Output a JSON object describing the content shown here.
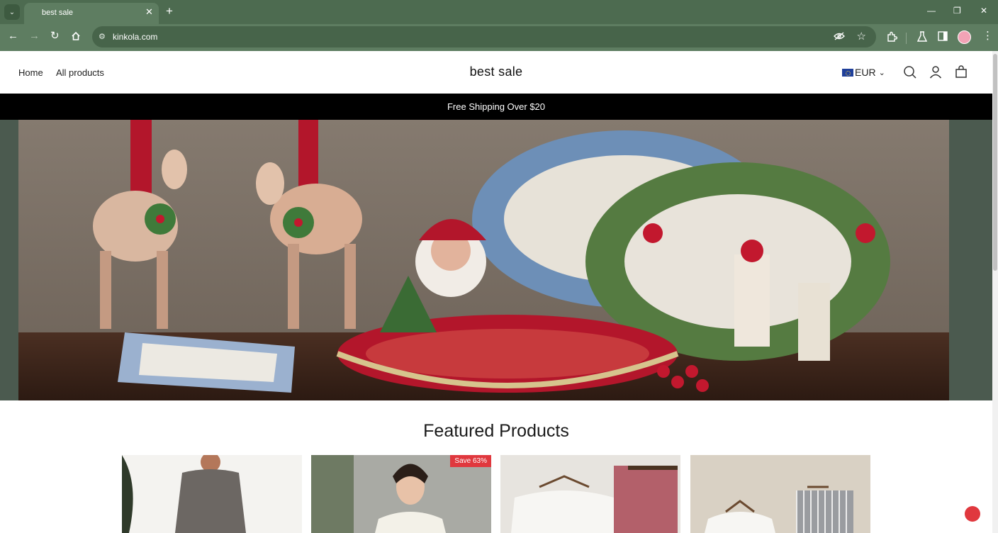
{
  "browser": {
    "tab_title": "best sale",
    "url": "kinkola.com"
  },
  "header": {
    "nav": [
      "Home",
      "All products"
    ],
    "logo": "best sale",
    "currency": "EUR"
  },
  "announcement": "Free Shipping Over $20",
  "hero": {
    "alt": "Christmas figurines: reindeer, Santa and holly-decorated platters"
  },
  "featured": {
    "title": "Featured Products",
    "products": [
      {
        "badge": ""
      },
      {
        "badge": "Save 63%"
      },
      {
        "badge": ""
      },
      {
        "badge": ""
      }
    ]
  },
  "colors": {
    "chrome": "#4d6b50",
    "toolbar": "#5e7d61",
    "announcement_bg": "#000000",
    "badge": "#e0383e"
  }
}
